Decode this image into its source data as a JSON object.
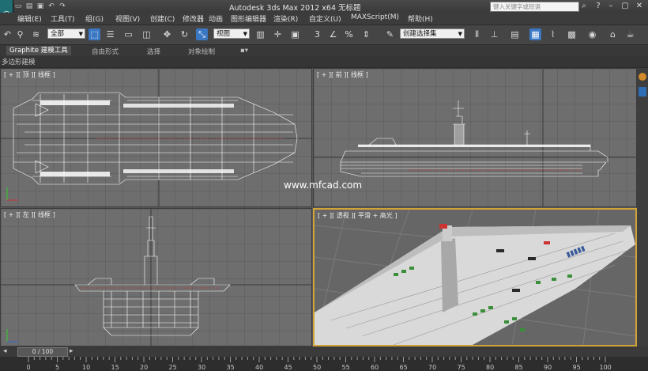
{
  "titlebar": {
    "title": "Autodesk 3ds Max  2012 x64    无标题",
    "search_placeholder": "键入关键字或短语"
  },
  "menu": [
    "编辑(E)",
    "工具(T)",
    "组(G)",
    "视图(V)",
    "创建(C)",
    "修改器",
    "动画",
    "图形编辑器",
    "渲染(R)",
    "自定义(U)",
    "MAXScript(M)",
    "帮助(H)"
  ],
  "toolbar": {
    "selection_filter": "全部",
    "reference_coord": "视图",
    "named_selection": "创建选择集"
  },
  "ribbon": {
    "tabs": [
      "Graphite 建模工具",
      "自由形式",
      "选择",
      "对象绘制"
    ],
    "sub_label": "多边形建模"
  },
  "viewports": {
    "top": "[ + ][ 顶 ][ 线框 ]",
    "front": "[ + ][ 前 ][ 线框 ]",
    "left": "[ + ][ 左 ][ 线框 ]",
    "perspective": "[ + ][ 透视 ][ 平滑 + 高光 ]"
  },
  "watermark": "www.mfcad.com",
  "timeline": {
    "frame_display": "0 / 100"
  },
  "track_ticks": [
    "0",
    "5",
    "10",
    "15",
    "20",
    "25",
    "30",
    "35",
    "40",
    "45",
    "50",
    "55",
    "60",
    "65",
    "70",
    "75",
    "80",
    "85",
    "90",
    "95",
    "100"
  ],
  "colors": {
    "viewport_bg": "#6e6e6e",
    "active_border": "#d2a437",
    "toolbar_bg": "#454545"
  }
}
